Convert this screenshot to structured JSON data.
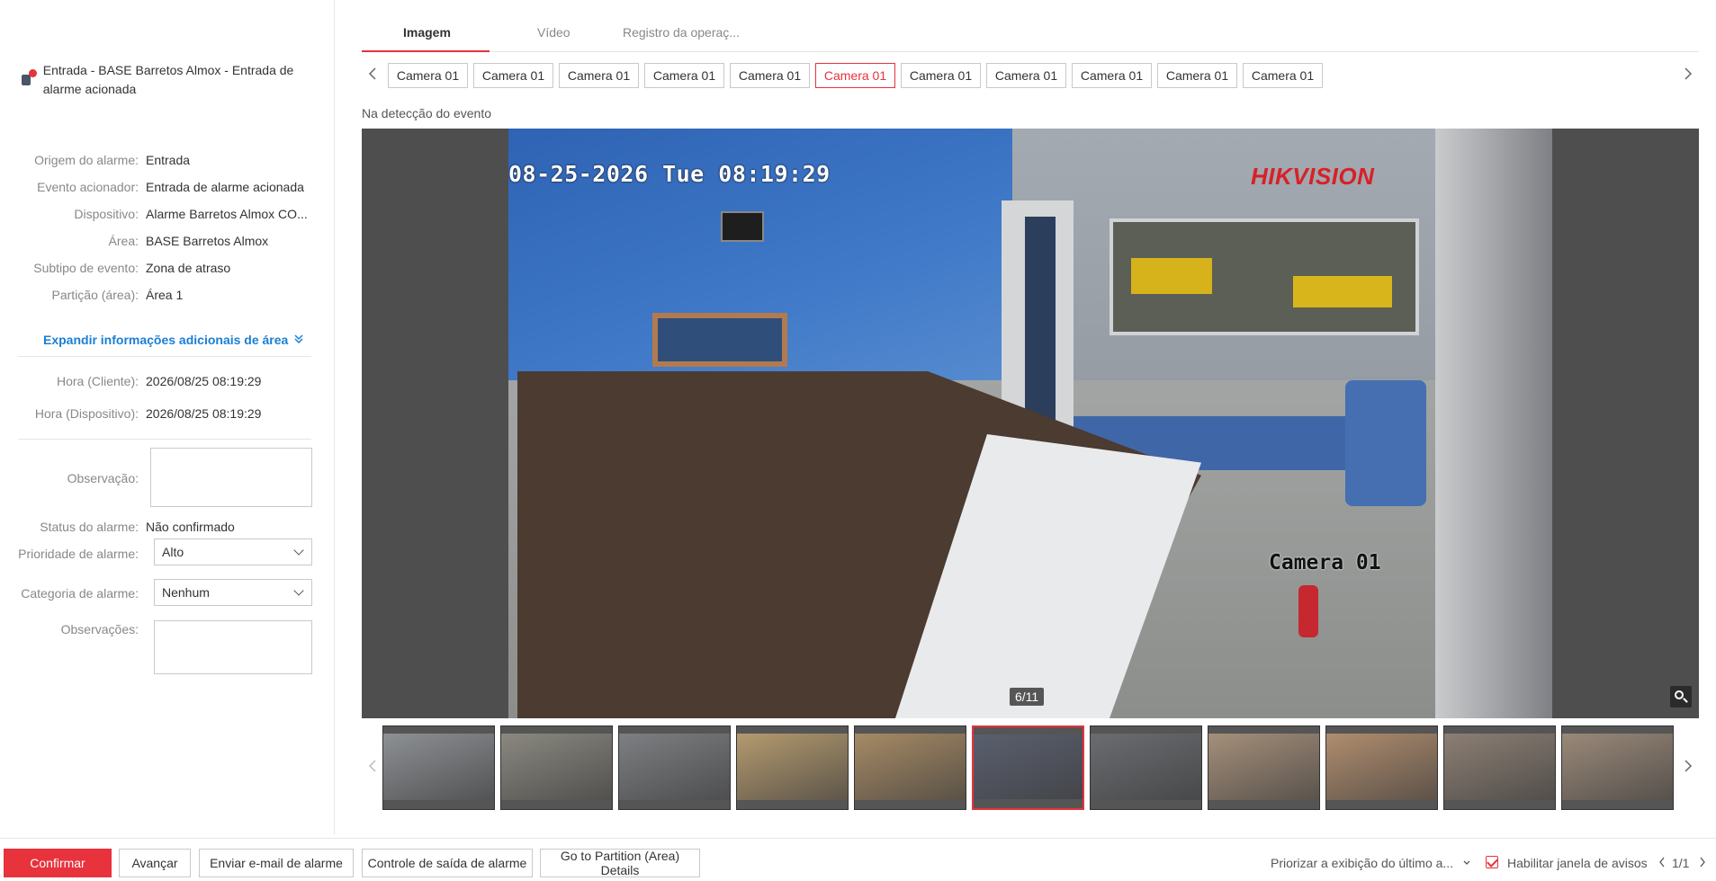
{
  "alarm": {
    "title": "Entrada - BASE Barretos Almox - Entrada de alarme acionada",
    "details": [
      {
        "label": "Origem do alarme:",
        "value": "Entrada"
      },
      {
        "label": "Evento acionador:",
        "value": "Entrada de alarme acionada"
      },
      {
        "label": "Dispositivo:",
        "value": "Alarme Barretos Almox CO..."
      },
      {
        "label": "Área:",
        "value": "BASE Barretos Almox"
      },
      {
        "label": "Subtipo de evento:",
        "value": "Zona de atraso"
      },
      {
        "label": "Partição (área):",
        "value": "Área 1"
      }
    ],
    "expand_label": "Expandir informações adicionais de área",
    "client_time_label": "Hora (Cliente):",
    "client_time": "2026/08/25 08:19:29",
    "device_time_label": "Hora (Dispositivo):",
    "device_time": "2026/08/25 08:19:29",
    "observation_label": "Observação:",
    "observation_value": "",
    "status_label": "Status do alarme:",
    "status_value": "Não confirmado",
    "priority_label": "Prioridade de alarme:",
    "priority_value": "Alto",
    "category_label": "Categoria de alarme:",
    "category_value": "Nenhum",
    "remarks_label": "Observações:",
    "remarks_value": ""
  },
  "tabs": [
    {
      "label": "Imagem",
      "active": true
    },
    {
      "label": "Vídeo",
      "active": false
    },
    {
      "label": "Registro da operaç...",
      "active": false
    }
  ],
  "cameras": {
    "items": [
      "Camera 01",
      "Camera 01",
      "Camera 01",
      "Camera 01",
      "Camera 01",
      "Camera 01",
      "Camera 01",
      "Camera 01",
      "Camera 01",
      "Camera 01",
      "Camera 01"
    ],
    "active_index": 5
  },
  "event_label": "Na detecção do evento",
  "viewer": {
    "osd_time": "08-25-2026 Tue 08:19:29",
    "osd_brand": "HIKVISION",
    "osd_camera": "Camera 01",
    "counter": "6/11"
  },
  "thumbnails": {
    "count": 11,
    "active_index": 5,
    "colors": [
      "#8d9094",
      "#8a8880",
      "#7d7f82",
      "#b49a6f",
      "#a68a65",
      "#5a5f6e",
      "#6a6c70",
      "#a58f7a",
      "#b08d6e",
      "#8c7f74",
      "#9a8979"
    ]
  },
  "footer": {
    "confirm": "Confirmar",
    "next": "Avançar",
    "email": "Enviar e-mail de alarme",
    "output": "Controle de saída de alarme",
    "partition": "Go to Partition (Area) Details",
    "prioritize": "Priorizar a exibição do último a...",
    "enable_popup": "Habilitar janela de avisos",
    "page": "1/1"
  },
  "colors": {
    "accent": "#e8323c",
    "link": "#1a7fd4"
  }
}
